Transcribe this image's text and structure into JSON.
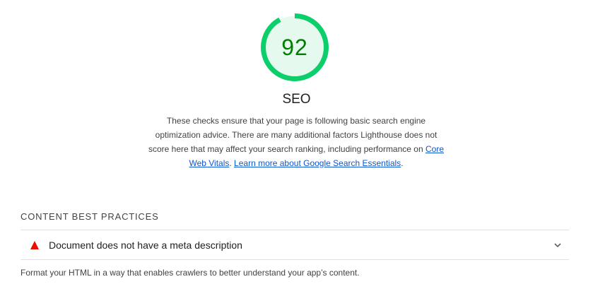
{
  "score": {
    "value": "92",
    "fraction": 0.92,
    "color": "#0cce6b",
    "fill": "#e5f9ee",
    "text_color": "#008000"
  },
  "category": {
    "title": "SEO",
    "description_text": "These checks ensure that your page is following basic search engine optimization advice. There are many additional factors Lighthouse does not score here that may affect your search ranking, including performance on ",
    "link_core_web_vitals": "Core Web Vitals",
    "separator": ". ",
    "link_learn_more": "Learn more about Google Search Essentials",
    "end": "."
  },
  "group": {
    "title": "CONTENT BEST PRACTICES",
    "description": "Format your HTML in a way that enables crawlers to better understand your app’s content."
  },
  "audits": [
    {
      "title": "Document does not have a meta description",
      "status": "fail",
      "status_color": "#eb0f00",
      "icon": "fail-triangle-icon",
      "expand_icon": "chevron-down-icon"
    }
  ]
}
